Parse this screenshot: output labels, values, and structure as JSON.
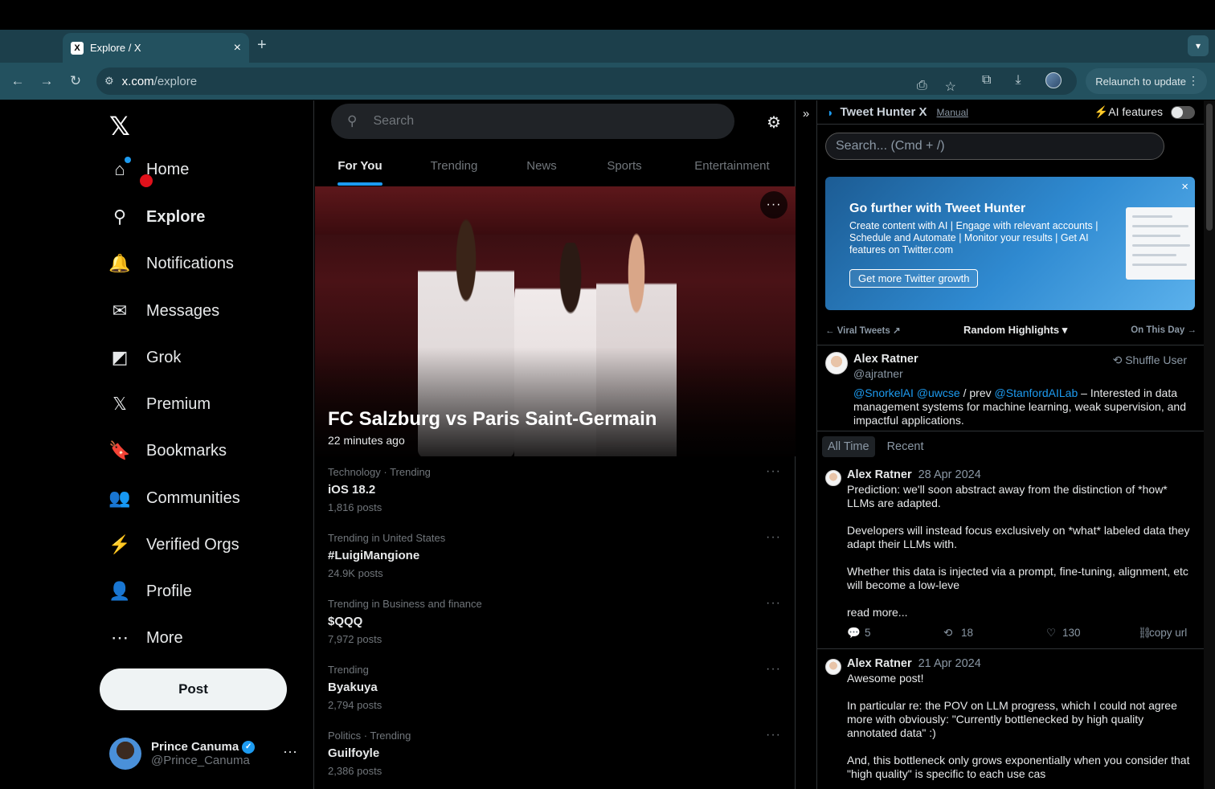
{
  "browser": {
    "tab_title": "Explore / X",
    "tab_favicon": "X",
    "tab_close": "×",
    "new_tab": "+",
    "url_host": "x.com",
    "url_path": "/explore",
    "relaunch_label": "Relaunch to update"
  },
  "sidebar": {
    "logo": "𝕏",
    "items": [
      {
        "label": "Home",
        "icon": "home-icon",
        "glyph": "⌂"
      },
      {
        "label": "Explore",
        "icon": "search-icon",
        "glyph": "⚲"
      },
      {
        "label": "Notifications",
        "icon": "bell-icon",
        "glyph": "🔔"
      },
      {
        "label": "Messages",
        "icon": "envelope-icon",
        "glyph": "✉"
      },
      {
        "label": "Grok",
        "icon": "grok-icon",
        "glyph": "◩"
      },
      {
        "label": "Premium",
        "icon": "x-icon",
        "glyph": "𝕏"
      },
      {
        "label": "Bookmarks",
        "icon": "bookmark-icon",
        "glyph": "🔖"
      },
      {
        "label": "Communities",
        "icon": "communities-icon",
        "glyph": "👥"
      },
      {
        "label": "Verified Orgs",
        "icon": "lightning-icon",
        "glyph": "⚡"
      },
      {
        "label": "Profile",
        "icon": "person-icon",
        "glyph": "👤"
      },
      {
        "label": "More",
        "icon": "more-circle-icon",
        "glyph": "⋯"
      }
    ],
    "post_label": "Post",
    "account": {
      "name": "Prince Canuma",
      "handle": "@Prince_Canuma",
      "verified_mark": "✓",
      "more": "···"
    }
  },
  "main": {
    "search_placeholder": "Search",
    "tabs": [
      "For You",
      "Trending",
      "News",
      "Sports",
      "Entertainment"
    ],
    "active_tab": "For You",
    "hero": {
      "title": "FC Salzburg vs Paris Saint-Germain",
      "time": "22 minutes ago",
      "more": "···"
    },
    "trends": [
      {
        "context": "Technology · Trending",
        "name": "iOS 18.2",
        "posts": "1,816 posts"
      },
      {
        "context": "Trending in United States",
        "name": "#LuigiMangione",
        "posts": "24.9K posts"
      },
      {
        "context": "Trending in Business and finance",
        "name": "$QQQ",
        "posts": "7,972 posts"
      },
      {
        "context": "Trending",
        "name": "Byakuya",
        "posts": "2,794 posts"
      },
      {
        "context": "Politics · Trending",
        "name": "Guilfoyle",
        "posts": "2,386 posts"
      }
    ],
    "trend_more": "···"
  },
  "extension": {
    "collapse": "»",
    "title": "Tweet Hunter X",
    "manual": "Manual",
    "ai_features": "⚡AI features",
    "search_placeholder": "Search... (Cmd + /)",
    "promo": {
      "title": "Go further with Tweet Hunter",
      "body": "Create content with AI | Engage with relevant accounts | Schedule and Automate | Monitor your results | Get AI features on Twitter.com",
      "button": "Get more Twitter growth",
      "close": "×"
    },
    "nav": {
      "left": "← Viral Tweets ↗",
      "center": "Random Highlights ▾",
      "right": "On This Day →"
    },
    "user": {
      "name": "Alex Ratner",
      "handle": "@ajratner",
      "shuffle": "⟲ Shuffle User",
      "bio_mention_1": "@SnorkelAI",
      "bio_mention_2": "@uwcse",
      "bio_mid": " / prev ",
      "bio_mention_3": "@StanfordAILab",
      "bio_rest": " – Interested in data management systems for machine learning, weak supervision, and impactful applications."
    },
    "time_tabs": [
      "All Time",
      "Recent"
    ],
    "tweets": [
      {
        "name": "Alex Ratner",
        "date": "28 Apr 2024",
        "text": "Prediction: we'll soon abstract away from the distinction of *how* LLMs are adapted.\n\nDevelopers will instead focus exclusively on *what* labeled data they adapt their LLMs with.\n\nWhether this data is injected via a prompt, fine-tuning, alignment, etc will become a low-leve\n\nread more...",
        "replies": "5",
        "retweets": "18",
        "likes": "130",
        "copy": "copy url"
      },
      {
        "name": "Alex Ratner",
        "date": "21 Apr 2024",
        "text": "Awesome post!\n\nIn particular re: the POV on LLM progress, which I could not agree more with obviously: \"Currently bottlenecked by high quality annotated data\" :)\n\nAnd, this bottleneck only grows exponentially when you consider that \"high quality\" is specific to each use cas"
      }
    ]
  },
  "colors": {
    "accent": "#1d9bf0",
    "background": "#000000",
    "chrome": "#23515f",
    "text": "#e7e9ea",
    "muted": "#71767b"
  }
}
